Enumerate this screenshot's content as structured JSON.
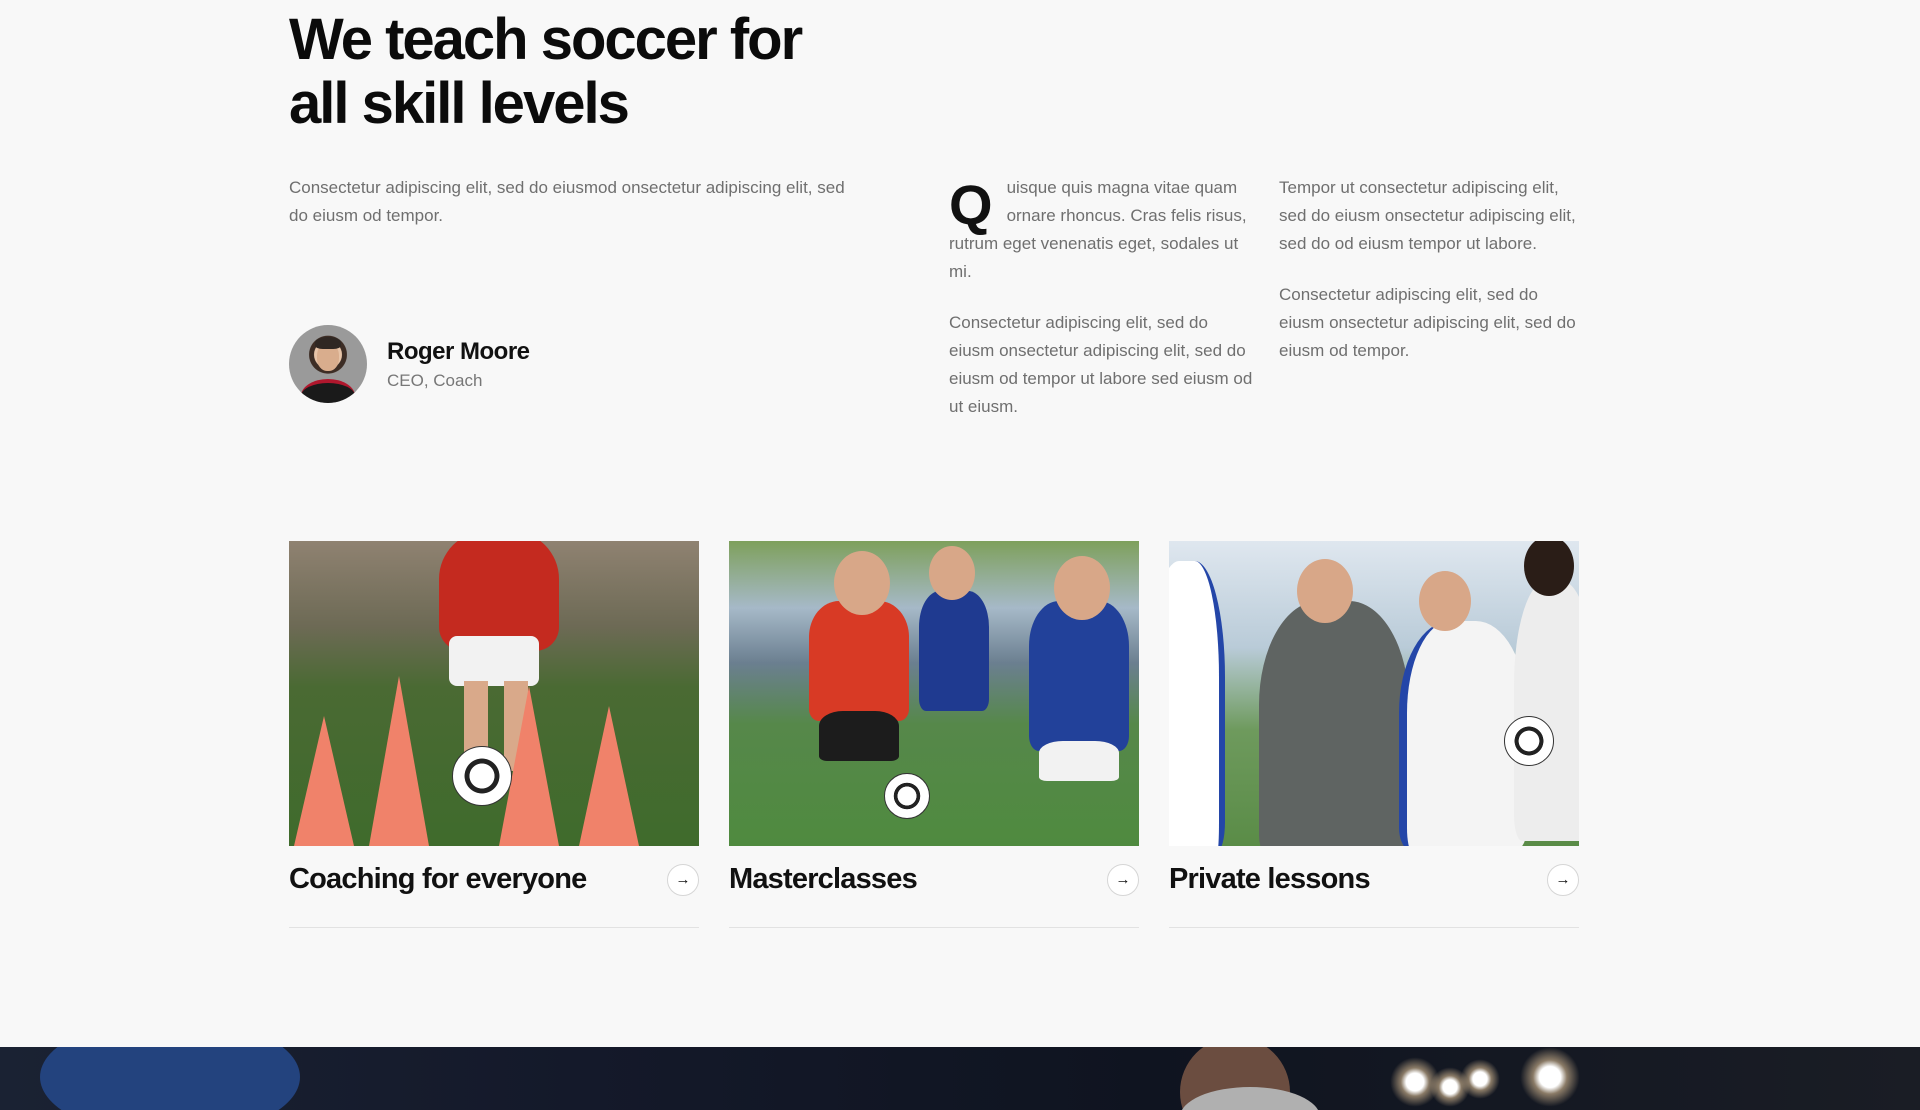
{
  "hero": {
    "headline_line1": "We teach soccer for",
    "headline_line2": "all skill levels",
    "intro": "Consectetur adipiscing elit, sed do eiusmod onsectetur adipiscing elit, sed do eiusm od tempor."
  },
  "author": {
    "name": "Roger Moore",
    "role": "CEO, Coach"
  },
  "columns": {
    "a": {
      "dropcap": "Q",
      "p1": "uisque quis magna vitae quam ornare rhoncus. Cras felis risus, rutrum eget venenatis eget, sodales ut mi.",
      "p2": "Consectetur adipiscing elit, sed do eiusm onsectetur adipiscing elit, sed do eiusm od tempor ut labore sed eiusm od ut eiusm."
    },
    "b": {
      "p1": "Tempor ut consectetur adipiscing elit, sed do eiusm onsectetur adipiscing elit, sed do od eiusm  tempor ut labore.",
      "p2": "Consectetur adipiscing elit, sed do eiusm onsectetur adipiscing elit, sed do eiusm od tempor."
    }
  },
  "cards": [
    {
      "title": "Coaching for everyone",
      "arrow": "→",
      "image_icon": "cones-photo"
    },
    {
      "title": "Masterclasses",
      "arrow": "→",
      "image_icon": "kids-playing-photo"
    },
    {
      "title": "Private lessons",
      "arrow": "→",
      "image_icon": "coach-with-players-photo"
    }
  ],
  "colors": {
    "background": "#f8f8f8",
    "text": "#111111",
    "muted": "#6f6f6f",
    "border": "#e2e2e2"
  }
}
